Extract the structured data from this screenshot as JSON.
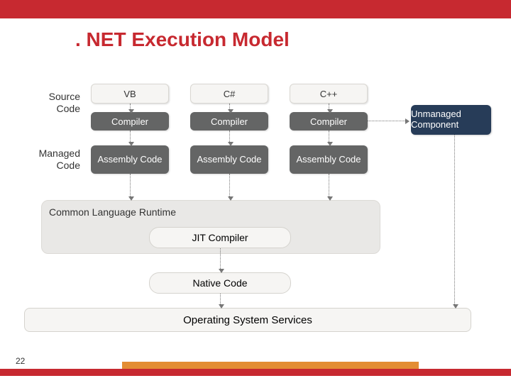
{
  "title": ". NET Execution Model",
  "labels": {
    "source": "Source Code",
    "managed": "Managed Code",
    "clr": "Common Language Runtime",
    "jit": "JIT Compiler",
    "native": "Native Code",
    "os": "Operating System Services",
    "unmanaged": "Unmanaged Component"
  },
  "columns": [
    {
      "lang": "VB",
      "compiler": "Compiler",
      "asm": "Assembly Code"
    },
    {
      "lang": "C#",
      "compiler": "Compiler",
      "asm": "Assembly Code"
    },
    {
      "lang": "C++",
      "compiler": "Compiler",
      "asm": "Assembly Code"
    }
  ],
  "slide_number": "22",
  "colors": {
    "accent_red": "#c72930",
    "accent_orange": "#e38d33",
    "darkblue": "#273c58",
    "gray": "#646565"
  }
}
